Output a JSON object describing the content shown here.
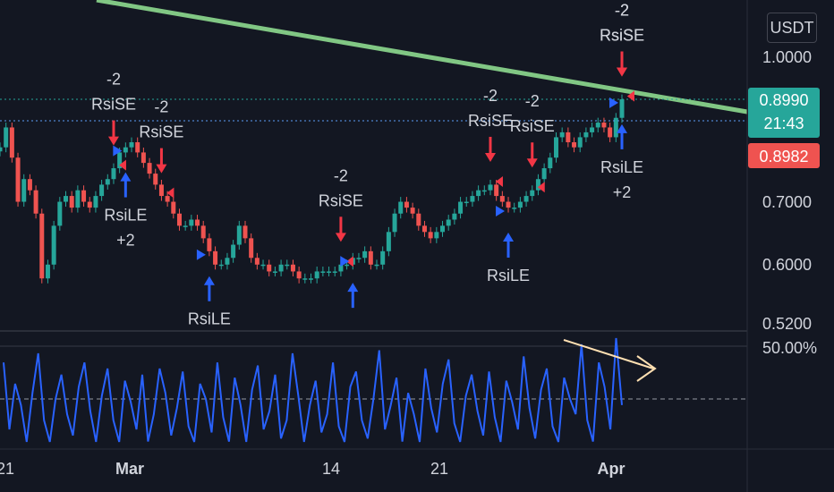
{
  "currency_button": "USDT",
  "price_tags": {
    "last_price": "0.8990",
    "countdown": "21:43",
    "bid_price": "0.8982",
    "last_color": "#26a69a",
    "bid_color": "#ef5350"
  },
  "colors": {
    "background": "#131722",
    "trendline": "#81c784",
    "candle_up": "#26a69a",
    "candle_down": "#ef5350",
    "short_arrow": "#f23645",
    "long_arrow": "#2962ff",
    "oscillator": "#2962ff",
    "oscillator_arrow": "#ffe0b2"
  },
  "chart_data": [
    {
      "type": "candlestick",
      "title": "",
      "y_axis": {
        "scale": "log",
        "ticks": [
          "1.0000",
          "0.7000",
          "0.6000",
          "0.5200"
        ]
      },
      "x_axis": {
        "ticks": [
          "21",
          "Mar",
          "14",
          "21",
          "Apr"
        ]
      },
      "close_series": [
        0.8,
        0.84,
        0.78,
        0.7,
        0.74,
        0.72,
        0.68,
        0.58,
        0.6,
        0.66,
        0.7,
        0.71,
        0.69,
        0.72,
        0.7,
        0.69,
        0.71,
        0.73,
        0.74,
        0.76,
        0.79,
        0.8,
        0.81,
        0.79,
        0.77,
        0.75,
        0.73,
        0.71,
        0.7,
        0.68,
        0.66,
        0.66,
        0.67,
        0.66,
        0.64,
        0.62,
        0.6,
        0.6,
        0.61,
        0.63,
        0.66,
        0.64,
        0.61,
        0.6,
        0.6,
        0.59,
        0.59,
        0.6,
        0.6,
        0.59,
        0.58,
        0.58,
        0.58,
        0.59,
        0.59,
        0.59,
        0.59,
        0.6,
        0.6,
        0.61,
        0.61,
        0.62,
        0.6,
        0.6,
        0.62,
        0.65,
        0.68,
        0.7,
        0.69,
        0.68,
        0.66,
        0.65,
        0.64,
        0.65,
        0.66,
        0.67,
        0.68,
        0.7,
        0.7,
        0.71,
        0.72,
        0.72,
        0.73,
        0.71,
        0.7,
        0.69,
        0.69,
        0.7,
        0.71,
        0.72,
        0.74,
        0.76,
        0.78,
        0.82,
        0.83,
        0.81,
        0.8,
        0.82,
        0.83,
        0.84,
        0.85,
        0.84,
        0.82,
        0.86,
        0.9
      ],
      "series": [
        {
          "name": "RsiSE",
          "labels": [
            "-2",
            "RsiSE"
          ]
        },
        {
          "name": "RsiLE",
          "labels": [
            "RsiLE",
            "+2"
          ]
        }
      ],
      "signals": [
        {
          "type": "short",
          "text": [
            "-2",
            "RsiSE"
          ],
          "index": 19
        },
        {
          "type": "short",
          "text": [
            "-2",
            "RsiSE"
          ],
          "index": 27
        },
        {
          "type": "long",
          "text": [
            "RsiLE",
            "+2"
          ],
          "index": 21
        },
        {
          "type": "long",
          "text": [
            "RsiLE",
            "+2"
          ],
          "index": 35
        },
        {
          "type": "short",
          "text": [
            "-2",
            "RsiSE"
          ],
          "index": 57
        },
        {
          "type": "long",
          "text": [
            "RsiLE"
          ],
          "index": 59
        },
        {
          "type": "short",
          "text": [
            "-2",
            "RsiSE"
          ],
          "index": 82
        },
        {
          "type": "short",
          "text": [
            "-2",
            "RsiSE"
          ],
          "index": 89
        },
        {
          "type": "long",
          "text": [
            "RsiLE"
          ],
          "index": 85
        },
        {
          "type": "short",
          "text": [
            "-2",
            "RsiSE"
          ],
          "index": 104
        },
        {
          "type": "short",
          "text": [
            "-2",
            "RsiSE"
          ],
          "index": 116
        },
        {
          "type": "long",
          "text": [
            "RsiLE",
            "+2"
          ],
          "index": 111
        }
      ]
    },
    {
      "type": "line",
      "title": "",
      "y_axis": {
        "ticks": [
          "50.00%"
        ]
      },
      "values": [
        52,
        30,
        45,
        38,
        25,
        42,
        55,
        33,
        20,
        40,
        48,
        35,
        28,
        44,
        52,
        36,
        24,
        41,
        50,
        33,
        22,
        46,
        39,
        30,
        48,
        26,
        35,
        50,
        42,
        28,
        37,
        49,
        31,
        23,
        45,
        40,
        29,
        52,
        34,
        26,
        47,
        38,
        24,
        43,
        51,
        30,
        36,
        48,
        27,
        33,
        55,
        41,
        25,
        38,
        46,
        29,
        35,
        52,
        31,
        22,
        44,
        49,
        33,
        27,
        40,
        56,
        30,
        38,
        47,
        26,
        42,
        35,
        24,
        50,
        37,
        29,
        45,
        53,
        32,
        21,
        41,
        48,
        36,
        28,
        49,
        34,
        25,
        46,
        39,
        30,
        54,
        37,
        27,
        43,
        50,
        31,
        22,
        47,
        40,
        35,
        58,
        33,
        26,
        52,
        44,
        30,
        60,
        38
      ]
    }
  ]
}
